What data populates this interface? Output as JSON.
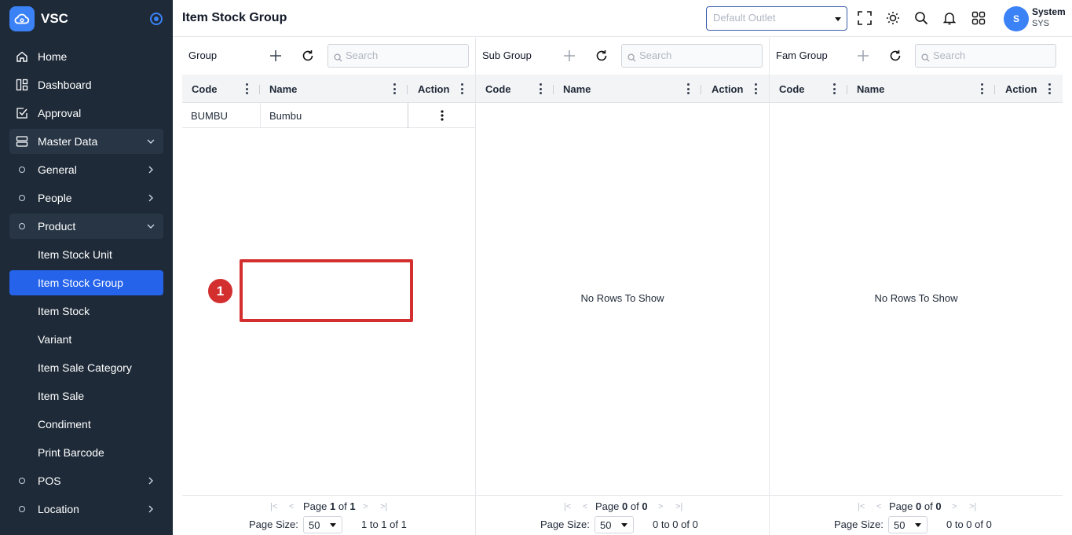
{
  "app": {
    "name": "VSC"
  },
  "sidebar": {
    "items": [
      {
        "label": "Home",
        "icon": "home-icon"
      },
      {
        "label": "Dashboard",
        "icon": "dashboard-icon"
      },
      {
        "label": "Approval",
        "icon": "approval-icon"
      },
      {
        "label": "Master Data",
        "icon": "database-icon"
      },
      {
        "label": "General",
        "icon": "circle-icon"
      },
      {
        "label": "People",
        "icon": "circle-icon"
      },
      {
        "label": "Product",
        "icon": "circle-icon"
      },
      {
        "label": "Item Stock Unit"
      },
      {
        "label": "Item Stock Group"
      },
      {
        "label": "Item Stock"
      },
      {
        "label": "Variant"
      },
      {
        "label": "Item Sale Category"
      },
      {
        "label": "Item Sale"
      },
      {
        "label": "Condiment"
      },
      {
        "label": "Print Barcode"
      },
      {
        "label": "POS",
        "icon": "circle-icon"
      },
      {
        "label": "Location",
        "icon": "circle-icon"
      }
    ]
  },
  "header": {
    "title": "Item Stock Group",
    "outlet_placeholder": "Default Outlet",
    "user": {
      "initial": "S",
      "name": "System",
      "code": "SYS"
    }
  },
  "panels": [
    {
      "title": "Group",
      "search_placeholder": "Search",
      "columns": [
        "Code",
        "Name",
        "Action"
      ],
      "rows": [
        {
          "code": "BUMBU",
          "name": "Bumbu"
        }
      ],
      "pager": {
        "page_label": "Page",
        "page": "1",
        "of_label": "of",
        "total_pages": "1",
        "size_label": "Page Size:",
        "size": "50",
        "range": "1 to 1 of 1"
      }
    },
    {
      "title": "Sub Group",
      "search_placeholder": "Search",
      "columns": [
        "Code",
        "Name",
        "Action"
      ],
      "empty_text": "No Rows To Show",
      "pager": {
        "page_label": "Page",
        "page": "0",
        "of_label": "of",
        "total_pages": "0",
        "size_label": "Page Size:",
        "size": "50",
        "range": "0 to 0 of 0"
      }
    },
    {
      "title": "Fam Group",
      "search_placeholder": "Search",
      "columns": [
        "Code",
        "Name",
        "Action"
      ],
      "empty_text": "No Rows To Show",
      "pager": {
        "page_label": "Page",
        "page": "0",
        "of_label": "of",
        "total_pages": "0",
        "size_label": "Page Size:",
        "size": "50",
        "range": "0 to 0 of 0"
      }
    }
  ],
  "annotation": {
    "label": "1",
    "color": "#d32f2f"
  },
  "colors": {
    "sidebar_bg": "#1e2a38",
    "accent": "#2563eb"
  }
}
